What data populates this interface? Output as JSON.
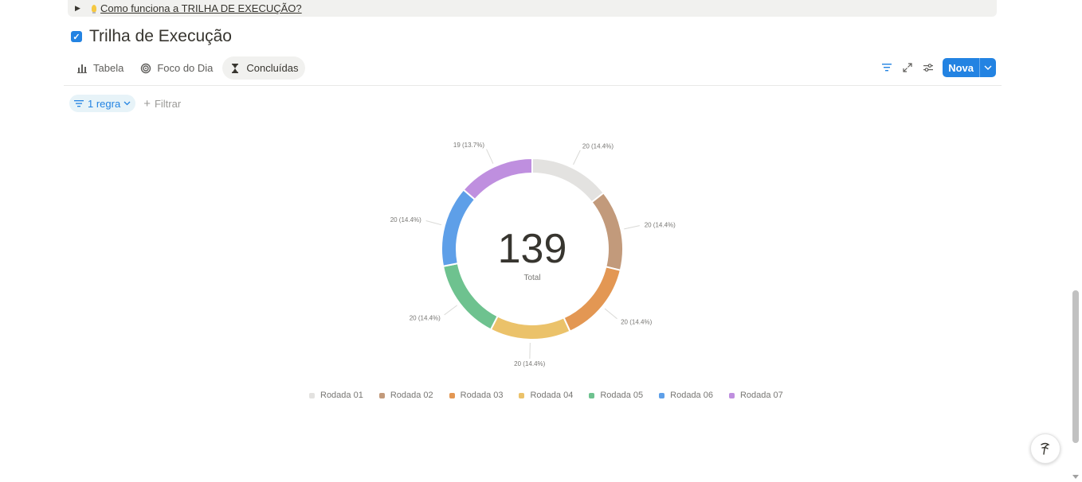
{
  "toggle": {
    "text": "Como funciona a TRILHA DE EXECUÇÃO?"
  },
  "page": {
    "title": "Trilha de Execução"
  },
  "tabs": [
    {
      "label": "Tabela",
      "icon": "bar-chart-icon"
    },
    {
      "label": "Foco do Dia",
      "icon": "target-icon"
    },
    {
      "label": "Concluídas",
      "icon": "hourglass-icon",
      "active": true
    }
  ],
  "toolbar": {
    "new_label": "Nova"
  },
  "filters": {
    "rule_label": "1 regra",
    "filter_label": "Filtrar"
  },
  "chart_data": {
    "type": "pie",
    "center_value": "139",
    "center_label": "Total",
    "categories": [
      "Rodada 01",
      "Rodada 02",
      "Rodada 03",
      "Rodada 04",
      "Rodada 05",
      "Rodada 06",
      "Rodada 07"
    ],
    "values": [
      20,
      20,
      20,
      20,
      20,
      20,
      19
    ],
    "labels": [
      "20 (14.4%)",
      "20 (14.4%)",
      "20 (14.4%)",
      "20 (14.4%)",
      "20 (14.4%)",
      "20 (14.4%)",
      "19 (13.7%)"
    ],
    "colors": [
      "#e3e2e0",
      "#c29a7b",
      "#e39753",
      "#ebc26a",
      "#6ec28f",
      "#5e9fe8",
      "#bf8fdf"
    ],
    "legend": "bottom"
  },
  "colors": {
    "accent": "#2383e2",
    "chip_bg": "#e7f3f8"
  }
}
